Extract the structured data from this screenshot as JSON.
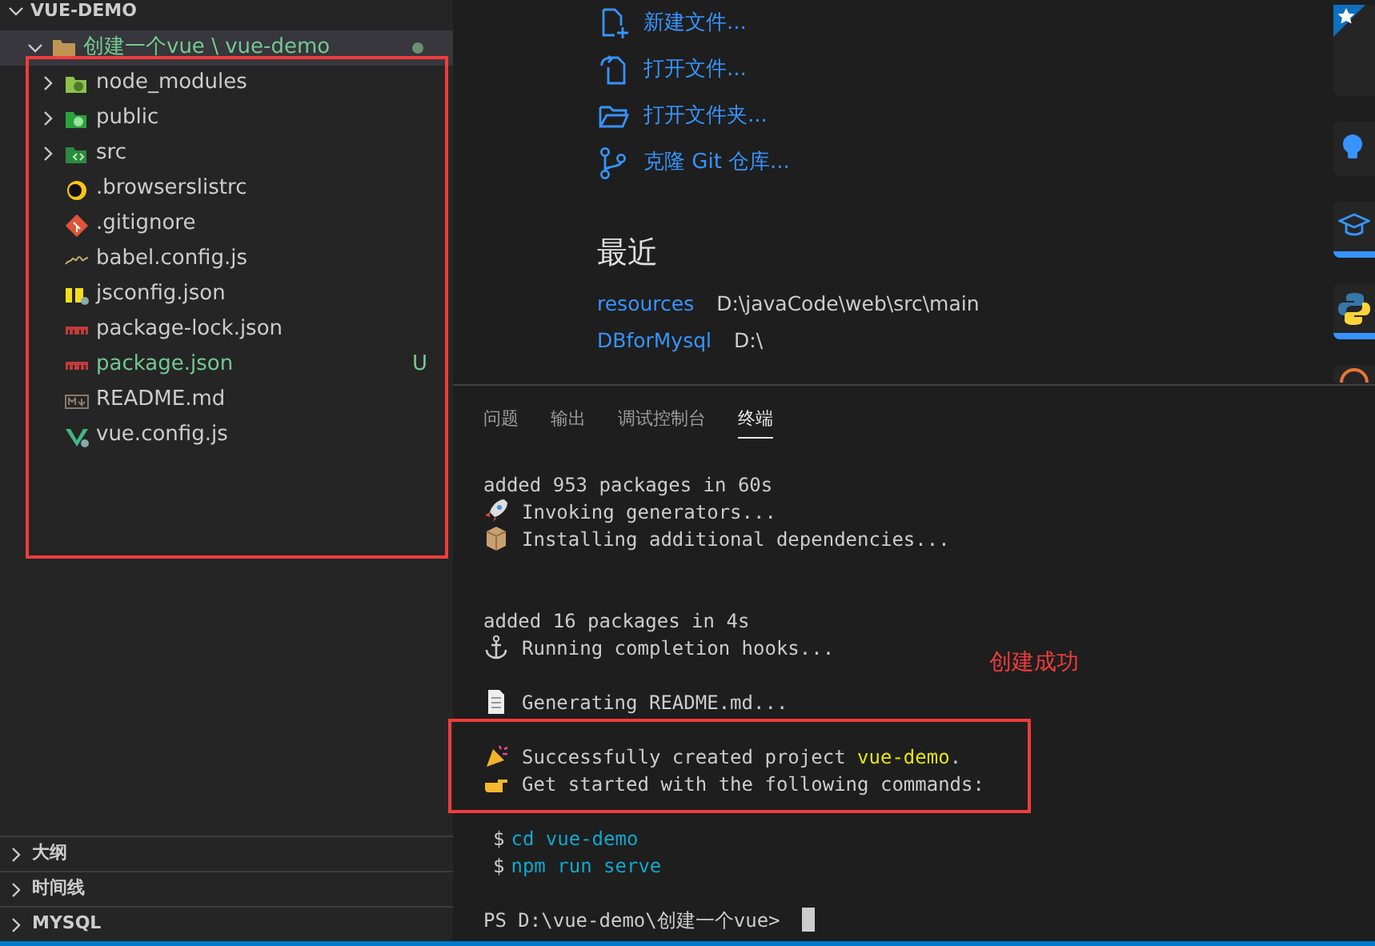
{
  "explorer": {
    "title": "VUE-DEMO",
    "expanded": true,
    "root": {
      "label": "创建一个vue \\ vue-demo",
      "selected": true,
      "expanded": true,
      "untracked": true,
      "modified": true,
      "children": [
        {
          "label": "node_modules",
          "kind": "folder-node",
          "selected": false,
          "expanded": false
        },
        {
          "label": "public",
          "kind": "folder-public",
          "selected": false,
          "expanded": false
        },
        {
          "label": "src",
          "kind": "folder-src",
          "selected": false,
          "expanded": false
        },
        {
          "label": ".browserslistrc",
          "kind": "browserslist",
          "selected": false
        },
        {
          "label": ".gitignore",
          "kind": "git",
          "selected": false
        },
        {
          "label": "babel.config.js",
          "kind": "babel",
          "selected": false
        },
        {
          "label": "jsconfig.json",
          "kind": "js",
          "selected": false
        },
        {
          "label": "package-lock.json",
          "kind": "npm",
          "selected": false
        },
        {
          "label": "package.json",
          "kind": "npm",
          "selected": false,
          "untracked": true,
          "status": "U"
        },
        {
          "label": "README.md",
          "kind": "markdown",
          "selected": false
        },
        {
          "label": "vue.config.js",
          "kind": "vue",
          "selected": false
        }
      ]
    }
  },
  "sidebar_sections": [
    {
      "label": "大纲",
      "expanded": false
    },
    {
      "label": "时间线",
      "expanded": false
    },
    {
      "label": "MYSQL",
      "expanded": false
    }
  ],
  "welcome": {
    "actions": [
      {
        "label": "新建文件...",
        "kind": "new-file"
      },
      {
        "label": "打开文件...",
        "kind": "open-file"
      },
      {
        "label": "打开文件夹...",
        "kind": "open-folder"
      },
      {
        "label": "克隆 Git 仓库...",
        "kind": "git-clone"
      }
    ],
    "recent_title": "最近",
    "recent": [
      {
        "name": "resources",
        "path": "D:\\javaCode\\web\\src\\main"
      },
      {
        "name": "DBforMysql",
        "path": "D:\\"
      }
    ],
    "cards": [
      {
        "kind": "star",
        "highlighted": false
      },
      {
        "kind": "bulb",
        "highlighted": false
      },
      {
        "kind": "mortarboard",
        "highlighted": true
      },
      {
        "kind": "python",
        "highlighted": true
      },
      {
        "kind": "partial",
        "highlighted": false
      }
    ]
  },
  "panel": {
    "tabs": [
      {
        "label": "问题",
        "selected": false
      },
      {
        "label": "输出",
        "selected": false
      },
      {
        "label": "调试控制台",
        "selected": false
      },
      {
        "label": "终端",
        "selected": true
      }
    ],
    "terminal": [
      {
        "kind": "text",
        "parts": [
          {
            "text": "added 953 packages in 60s"
          }
        ]
      },
      {
        "kind": "rocket",
        "parts": [
          {
            "text": "Invoking generators..."
          }
        ]
      },
      {
        "kind": "package",
        "parts": [
          {
            "text": "Installing additional dependencies..."
          }
        ]
      },
      {
        "kind": "blank"
      },
      {
        "kind": "blank"
      },
      {
        "kind": "text",
        "parts": [
          {
            "text": "added 16 packages in 4s"
          }
        ]
      },
      {
        "kind": "anchor",
        "parts": [
          {
            "text": "Running completion hooks..."
          }
        ]
      },
      {
        "kind": "blank"
      },
      {
        "kind": "page",
        "parts": [
          {
            "text": "Generating README.md..."
          }
        ]
      },
      {
        "kind": "blank"
      },
      {
        "kind": "party",
        "parts": [
          {
            "text": "Successfully created project "
          },
          {
            "text": "vue-demo",
            "kind": "highlight"
          },
          {
            "text": "."
          }
        ]
      },
      {
        "kind": "hand",
        "parts": [
          {
            "text": "Get started with the following commands:"
          }
        ]
      },
      {
        "kind": "blank"
      },
      {
        "kind": "command",
        "parts": [
          {
            "text": "$",
            "kind": "prompt"
          },
          {
            "text": "cd vue-demo",
            "kind": "cmd"
          }
        ]
      },
      {
        "kind": "command",
        "parts": [
          {
            "text": "$",
            "kind": "prompt"
          },
          {
            "text": "npm run serve",
            "kind": "cmd"
          }
        ]
      },
      {
        "kind": "blank"
      },
      {
        "kind": "prompt-line",
        "parts": [
          {
            "text": "PS D:\\vue-demo\\创建一个vue>"
          }
        ],
        "cursor": true
      }
    ]
  },
  "annotation": {
    "label": "创建成功"
  }
}
